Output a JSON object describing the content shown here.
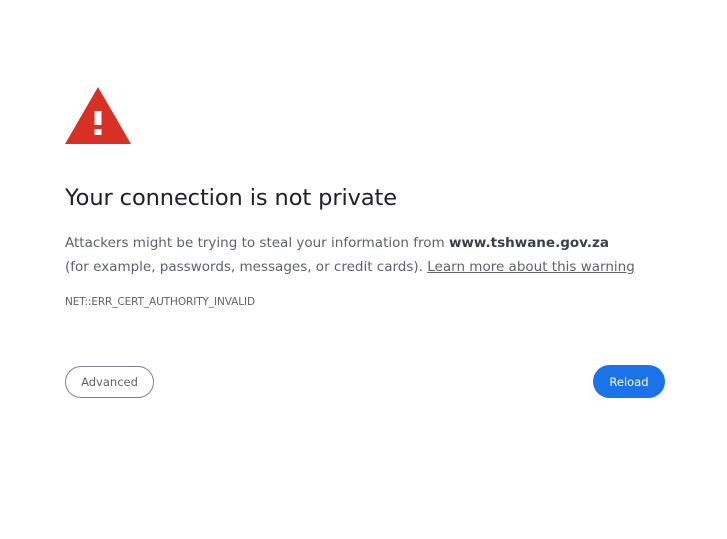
{
  "icon": {
    "name": "warning-triangle-icon",
    "color": "#d93025"
  },
  "title": "Your connection is not private",
  "message": {
    "before": "Attackers might be trying to steal your information from ",
    "domain": "www.tshwane.gov.za",
    "after": " (for example, passwords, messages, or credit cards). ",
    "link": "Learn more about this warning"
  },
  "error_code": "NET::ERR_CERT_AUTHORITY_INVALID",
  "buttons": {
    "advanced": "Advanced",
    "reload": "Reload"
  },
  "colors": {
    "primary": "#1a73e8",
    "danger": "#d93025",
    "text": "#202124",
    "secondary_text": "#5f6368"
  }
}
